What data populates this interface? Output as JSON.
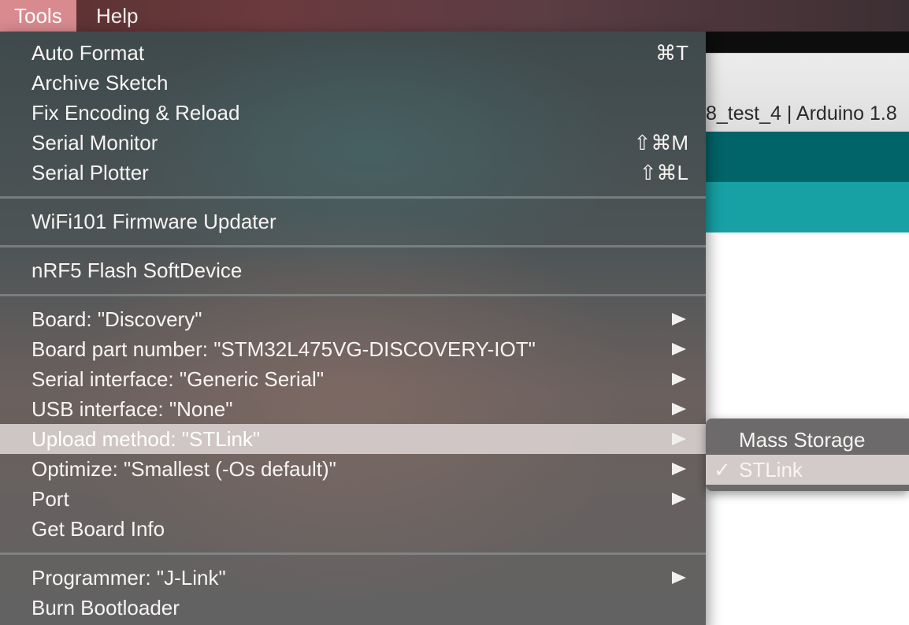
{
  "menubar": {
    "items": [
      {
        "label": "Tools",
        "active": true
      },
      {
        "label": "Help",
        "active": false
      }
    ]
  },
  "window": {
    "title": "8_test_4 | Arduino 1.8"
  },
  "tools_menu": {
    "items": [
      {
        "label": "Auto Format",
        "shortcut": "⌘T"
      },
      {
        "label": "Archive Sketch",
        "shortcut": ""
      },
      {
        "label": "Fix Encoding & Reload",
        "shortcut": ""
      },
      {
        "label": "Serial Monitor",
        "shortcut": "⇧⌘M"
      },
      {
        "label": "Serial Plotter",
        "shortcut": "⇧⌘L"
      },
      {
        "label": "WiFi101 Firmware Updater",
        "shortcut": ""
      },
      {
        "label": "nRF5 Flash SoftDevice",
        "shortcut": ""
      },
      {
        "label": "Board: \"Discovery\"",
        "submenu": true
      },
      {
        "label": "Board part number: \"STM32L475VG-DISCOVERY-IOT\"",
        "submenu": true
      },
      {
        "label": "Serial interface: \"Generic Serial\"",
        "submenu": true
      },
      {
        "label": "USB interface: \"None\"",
        "submenu": true
      },
      {
        "label": "Upload method: \"STLink\"",
        "submenu": true,
        "highlighted": true
      },
      {
        "label": "Optimize: \"Smallest (-Os default)\"",
        "submenu": true
      },
      {
        "label": "Port",
        "submenu": true
      },
      {
        "label": "Get Board Info",
        "submenu": false
      },
      {
        "label": "Programmer: \"J-Link\"",
        "submenu": true
      },
      {
        "label": "Burn Bootloader",
        "submenu": false
      }
    ]
  },
  "upload_method_submenu": {
    "check_mark": "✓",
    "items": [
      {
        "label": "Mass Storage",
        "selected": false
      },
      {
        "label": "STLink",
        "selected": true
      }
    ]
  },
  "colors": {
    "menubar_active": "#d88a8e",
    "ide_toolbar": "#006468",
    "ide_tabbar": "#17a1a5",
    "highlight": "#d6cecc"
  }
}
